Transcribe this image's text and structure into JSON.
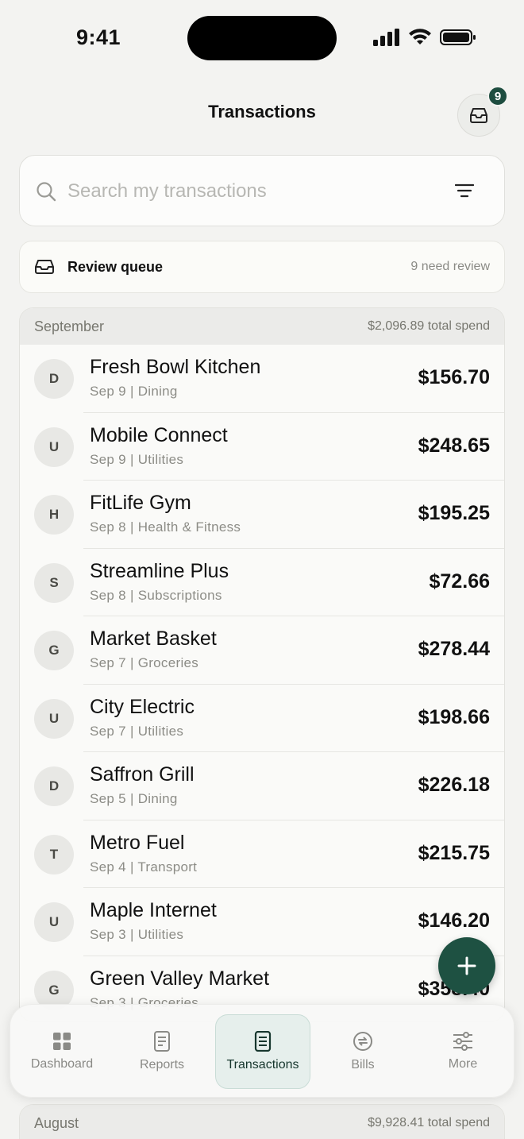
{
  "status_bar": {
    "time": "9:41"
  },
  "header": {
    "title": "Transactions",
    "inbox_badge": "9"
  },
  "search": {
    "placeholder": "Search my transactions",
    "value": ""
  },
  "review_queue": {
    "label": "Review queue",
    "count_text": "9 need review"
  },
  "groups": [
    {
      "month": "September",
      "total": "$2,096.89 total spend",
      "transactions": [
        {
          "initial": "D",
          "name": "Fresh Bowl Kitchen",
          "meta": "Sep 9 | Dining",
          "amount": "$156.70"
        },
        {
          "initial": "U",
          "name": "Mobile Connect",
          "meta": "Sep 9 | Utilities",
          "amount": "$248.65"
        },
        {
          "initial": "H",
          "name": "FitLife Gym",
          "meta": "Sep 8 | Health & Fitness",
          "amount": "$195.25"
        },
        {
          "initial": "S",
          "name": "Streamline Plus",
          "meta": "Sep 8 | Subscriptions",
          "amount": "$72.66"
        },
        {
          "initial": "G",
          "name": "Market Basket",
          "meta": "Sep 7 | Groceries",
          "amount": "$278.44"
        },
        {
          "initial": "U",
          "name": "City Electric",
          "meta": "Sep 7 | Utilities",
          "amount": "$198.66"
        },
        {
          "initial": "D",
          "name": "Saffron Grill",
          "meta": "Sep 5 | Dining",
          "amount": "$226.18"
        },
        {
          "initial": "T",
          "name": "Metro Fuel",
          "meta": "Sep 4 | Transport",
          "amount": "$215.75"
        },
        {
          "initial": "U",
          "name": "Maple Internet",
          "meta": "Sep 3 | Utilities",
          "amount": "$146.20"
        },
        {
          "initial": "G",
          "name": "Green Valley Market",
          "meta": "Sep 3 | Groceries",
          "amount": "$358.40"
        }
      ]
    },
    {
      "month": "August",
      "total": "$9,928.41 total spend"
    }
  ],
  "tabs": [
    {
      "label": "Dashboard",
      "icon": "grid-icon",
      "active": false
    },
    {
      "label": "Reports",
      "icon": "document-icon",
      "active": false
    },
    {
      "label": "Transactions",
      "icon": "list-icon",
      "active": true
    },
    {
      "label": "Bills",
      "icon": "refresh-icon",
      "active": false
    },
    {
      "label": "More",
      "icon": "sliders-icon",
      "active": false
    }
  ],
  "colors": {
    "accent": "#1e5142",
    "badge": "#1e4d40",
    "background": "#f3f3f1"
  }
}
